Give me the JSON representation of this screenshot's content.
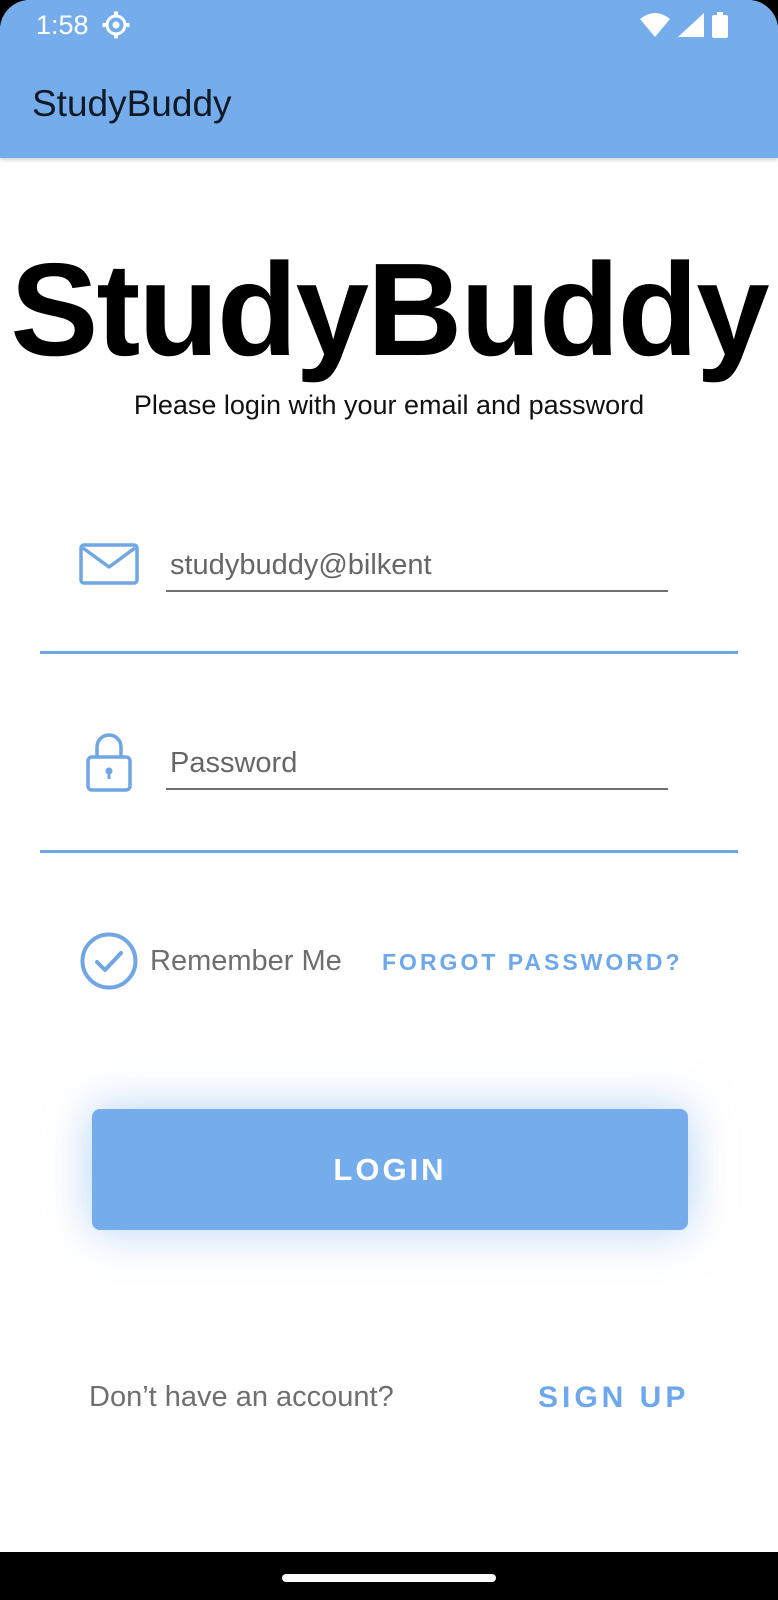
{
  "status_bar": {
    "time": "1:58",
    "icons": [
      "settings-icon",
      "wifi-icon",
      "cell-signal-icon",
      "battery-icon"
    ]
  },
  "app_bar": {
    "title": "StudyBuddy"
  },
  "header": {
    "brand": "StudyBuddy",
    "subtitle": "Please login with your email and password"
  },
  "email_field": {
    "icon": "mail-icon",
    "value": "studybuddy@bilkent"
  },
  "password_field": {
    "icon": "lock-icon",
    "placeholder": "Password"
  },
  "options": {
    "remember_label": "Remember Me",
    "remember_checked": true,
    "forgot_label": "FORGOT PASSWORD?"
  },
  "login_button": {
    "label": "LOGIN"
  },
  "footer": {
    "prompt": "Don’t have an account?",
    "signup_label": "SIGN UP"
  },
  "colors": {
    "accent": "#75adec",
    "link": "#6ea8ec",
    "divider": "#6fa6e3"
  }
}
